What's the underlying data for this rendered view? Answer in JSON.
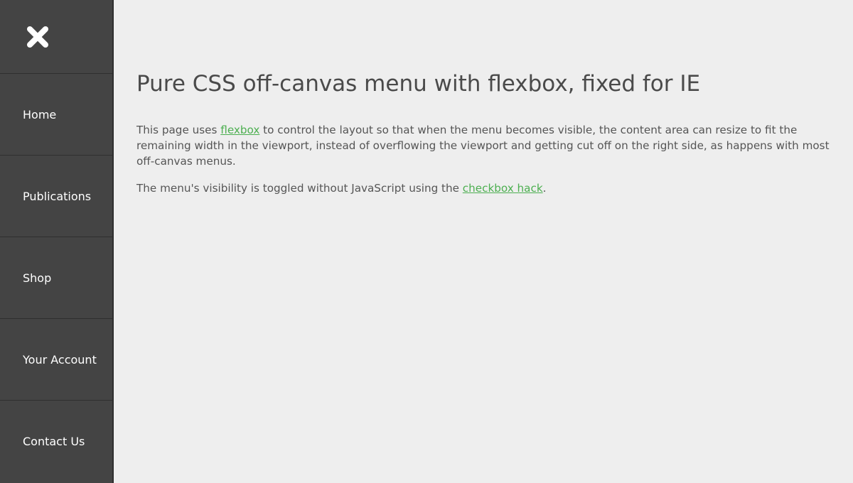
{
  "sidebar": {
    "close_icon": "close-icon",
    "items": [
      {
        "label": "Home"
      },
      {
        "label": "Publications"
      },
      {
        "label": "Shop"
      },
      {
        "label": "Your Account"
      },
      {
        "label": "Contact Us"
      }
    ]
  },
  "main": {
    "title": "Pure CSS off-canvas menu with flexbox, fixed for IE",
    "paragraph1": {
      "before": "This page uses ",
      "link": "flexbox",
      "after": " to control the layout so that when the menu becomes visible, the content area can resize to fit the remaining width in the viewport, instead of overflowing the viewport and getting cut off on the right side, as happens with most off-canvas menus."
    },
    "paragraph2": {
      "before": "The menu's visibility is toggled without JavaScript using the ",
      "link": "checkbox hack",
      "after": "."
    }
  },
  "colors": {
    "sidebar_bg": "#444444",
    "page_bg": "#eeeeee",
    "link": "#4caf50",
    "text": "#555555"
  }
}
